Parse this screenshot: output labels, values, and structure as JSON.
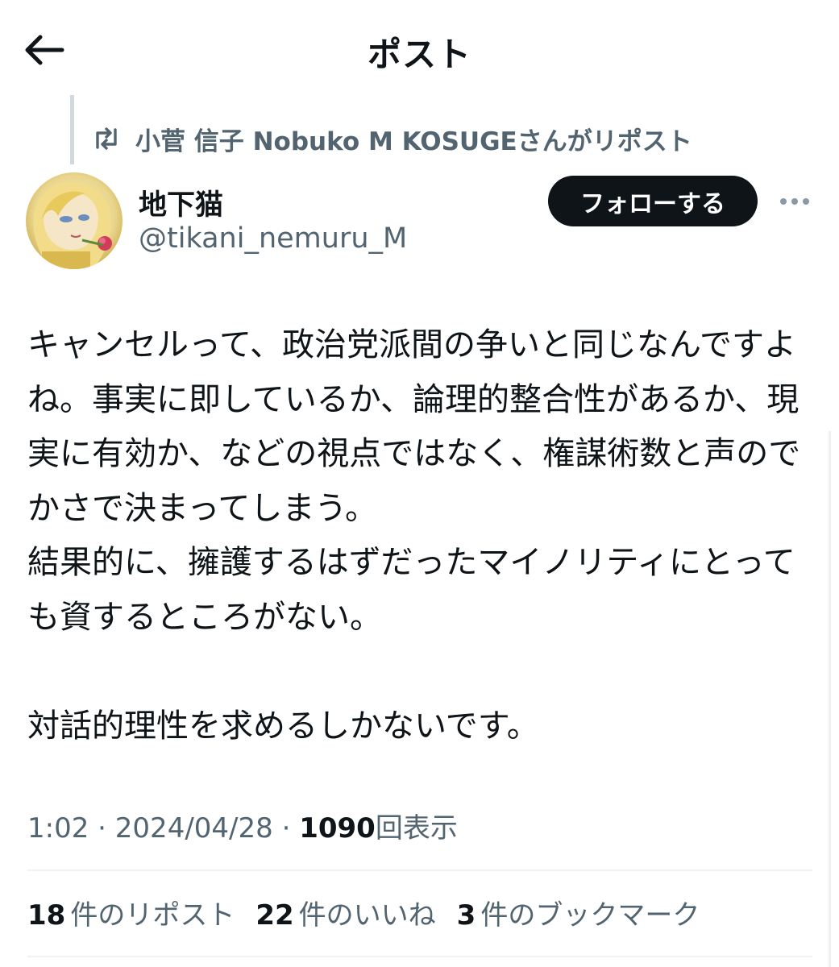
{
  "header": {
    "title": "ポスト",
    "back_icon": "arrow-left-icon"
  },
  "repost": {
    "icon": "repost-icon",
    "text": "小菅 信子 Nobuko M KOSUGEさんがリポスト"
  },
  "author": {
    "display_name": "地下猫",
    "handle": "@tikani_nemuru_M",
    "avatar": "illustrated-portrait-avatar"
  },
  "actions": {
    "follow_label": "フォローする",
    "more_icon": "more-dots-icon"
  },
  "post": {
    "text": "キャンセルって、政治党派間の争いと同じなんですよね。事実に即しているか、論理的整合性があるか、現実に有効か、などの視点ではなく、権謀術数と声のでかさで決まってしまう。\n結果的に、擁護するはずだったマイノリティにとっても資するところがない。\n\n対話的理性を求めるしかないです。"
  },
  "meta": {
    "time": "1:02",
    "separator": "·",
    "date": "2024/04/28",
    "views": "1090",
    "views_label": "回表示"
  },
  "stats": [
    {
      "count": "18",
      "label": "件のリポスト"
    },
    {
      "count": "22",
      "label": "件のいいね"
    },
    {
      "count": "3",
      "label": "件のブックマーク"
    }
  ],
  "colors": {
    "text": "#0f1419",
    "secondary": "#536471",
    "divider": "#eff3f4",
    "follow_bg": "#0f1419",
    "follow_text": "#ffffff"
  }
}
